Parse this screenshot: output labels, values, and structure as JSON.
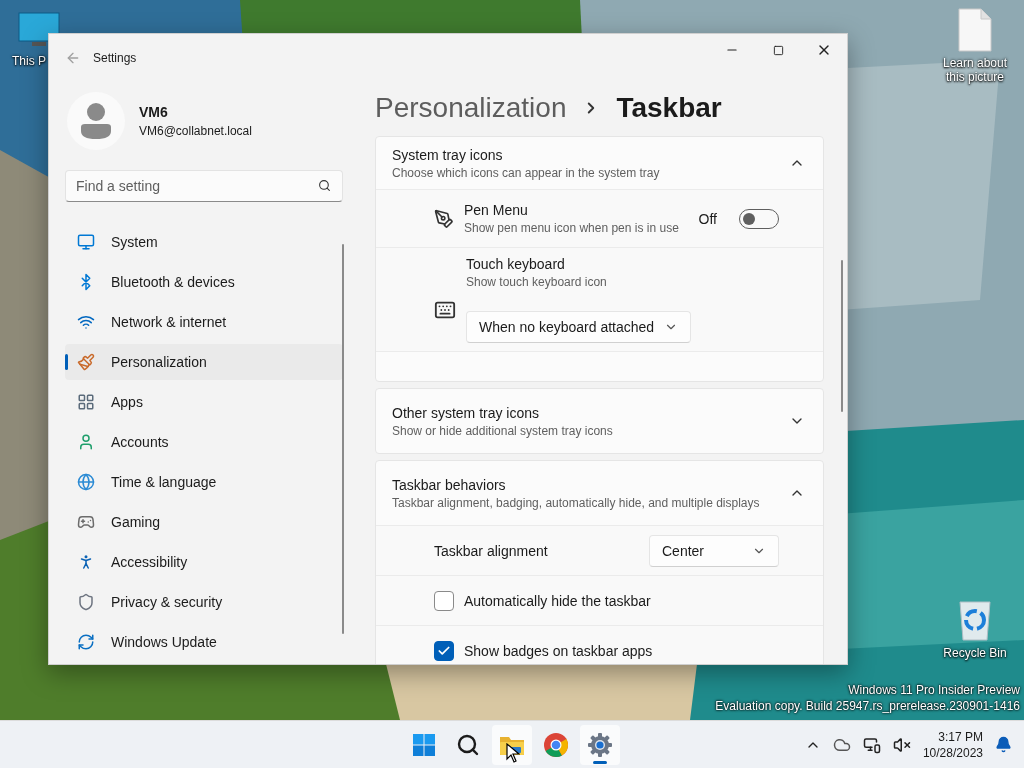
{
  "desktop": {
    "icons": [
      {
        "kind": "pc",
        "label": "This P"
      },
      {
        "kind": "document",
        "label": "Learn about this picture"
      },
      {
        "kind": "recycle",
        "label": "Recycle Bin"
      }
    ],
    "watermark": [
      "Windows 11 Pro Insider Preview",
      "Evaluation copy. Build 25947.rs_prerelease.230901-1416"
    ]
  },
  "window": {
    "title": "Settings",
    "user": {
      "name": "VM6",
      "email": "VM6@collabnet.local"
    },
    "search": {
      "placeholder": "Find a setting"
    },
    "nav": [
      {
        "label": "System",
        "selected": false
      },
      {
        "label": "Bluetooth & devices",
        "selected": false
      },
      {
        "label": "Network & internet",
        "selected": false
      },
      {
        "label": "Personalization",
        "selected": true
      },
      {
        "label": "Apps",
        "selected": false
      },
      {
        "label": "Accounts",
        "selected": false
      },
      {
        "label": "Time & language",
        "selected": false
      },
      {
        "label": "Gaming",
        "selected": false
      },
      {
        "label": "Accessibility",
        "selected": false
      },
      {
        "label": "Privacy & security",
        "selected": false
      },
      {
        "label": "Windows Update",
        "selected": false
      }
    ],
    "breadcrumb": {
      "parent": "Personalization",
      "current": "Taskbar"
    },
    "sections": [
      {
        "title": "System tray icons",
        "description": "Choose which icons can appear in the system tray",
        "expanded": true,
        "items": [
          {
            "kind": "toggle",
            "title": "Pen Menu",
            "description": "Show pen menu icon when pen is in use",
            "state_label": "Off",
            "on": false
          },
          {
            "kind": "dropdown",
            "title": "Touch keyboard",
            "description": "Show touch keyboard icon",
            "value": "When no keyboard attached"
          }
        ]
      },
      {
        "title": "Other system tray icons",
        "description": "Show or hide additional system tray icons",
        "expanded": false
      },
      {
        "title": "Taskbar behaviors",
        "description": "Taskbar alignment, badging, automatically hide, and multiple displays",
        "expanded": true,
        "items": [
          {
            "kind": "select",
            "title": "Taskbar alignment",
            "value": "Center"
          },
          {
            "kind": "checkbox",
            "title": "Automatically hide the taskbar",
            "checked": false
          },
          {
            "kind": "checkbox",
            "title": "Show badges on taskbar apps",
            "checked": true
          }
        ]
      }
    ]
  },
  "taskbar": {
    "apps": [
      {
        "kind": "start",
        "highlighted": false,
        "running": false
      },
      {
        "kind": "search",
        "highlighted": false,
        "running": false
      },
      {
        "kind": "explorer",
        "highlighted": true,
        "running": false
      },
      {
        "kind": "chrome",
        "highlighted": false,
        "running": false
      },
      {
        "kind": "settings",
        "highlighted": true,
        "running": true
      }
    ],
    "clock": {
      "time": "3:17 PM",
      "date": "10/28/2023"
    }
  }
}
